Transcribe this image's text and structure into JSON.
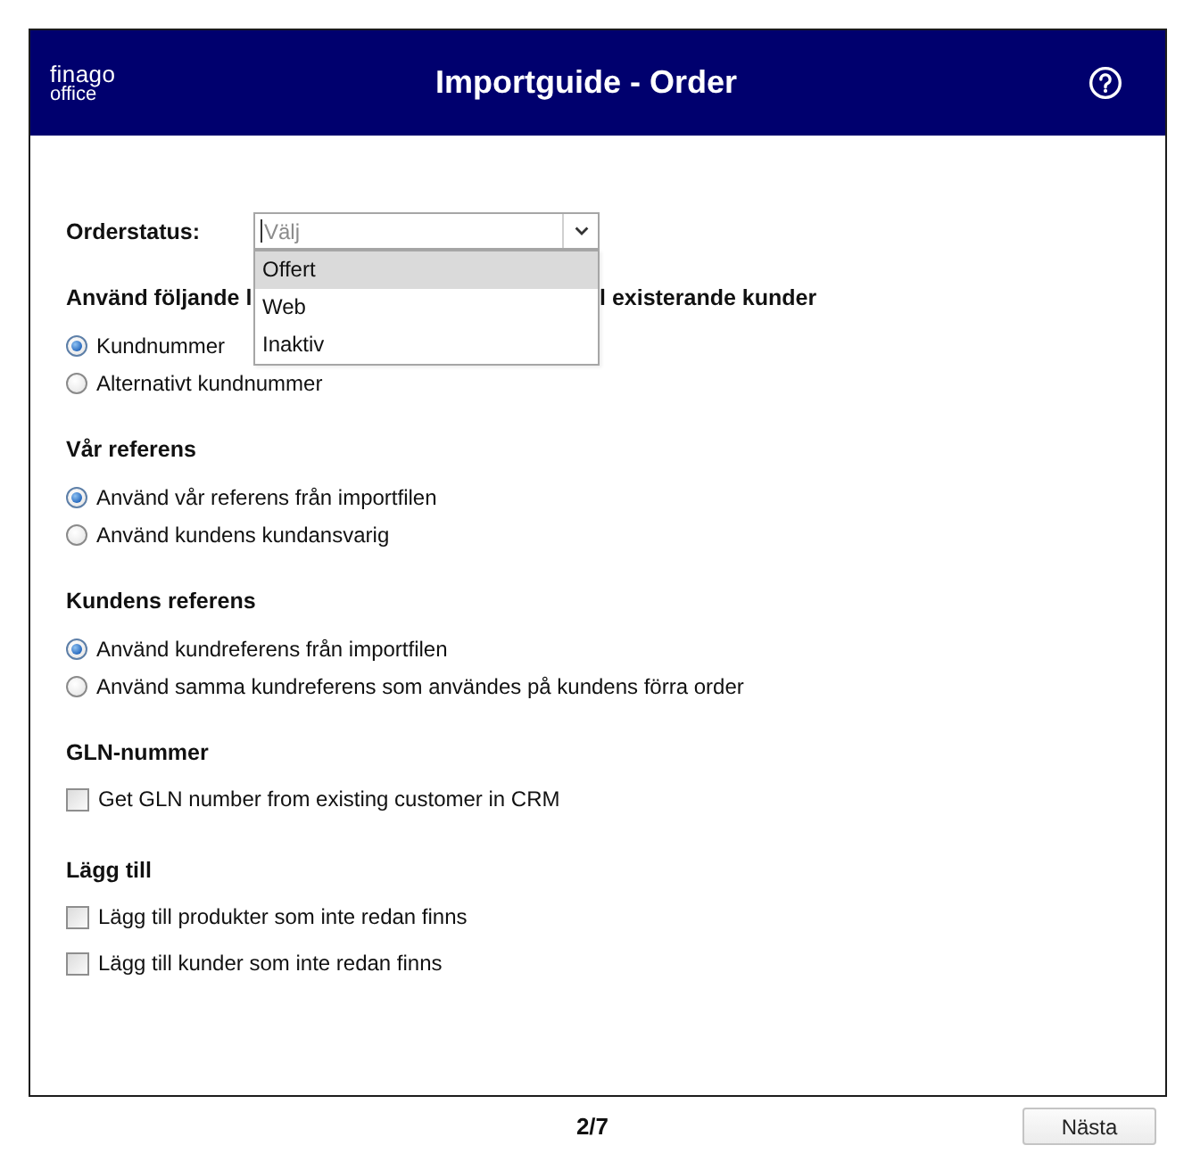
{
  "window": {
    "logo": {
      "line_1": "finago",
      "line_2": "office"
    },
    "title": "Importguide - Order"
  },
  "orderstatus": {
    "label": "Orderstatus:",
    "placeholder": "Välj",
    "focused": true,
    "expanded": true,
    "options": [
      {
        "label": "Offert",
        "selected": true
      },
      {
        "label": "Web",
        "selected": false
      },
      {
        "label": "Inaktiv",
        "selected": false
      }
    ]
  },
  "sections": [
    {
      "heading": "Använd följande l",
      "heading_continued": "l existerande kunder",
      "kind": "radio",
      "options": [
        {
          "label": "Kundnummer",
          "selected": true
        },
        {
          "label": "Alternativt kundnummer",
          "selected": false
        }
      ]
    },
    {
      "heading": "Vår referens",
      "kind": "radio",
      "options": [
        {
          "label": "Använd vår referens från importfilen",
          "selected": true
        },
        {
          "label": "Använd kundens kundansvarig",
          "selected": false
        }
      ]
    },
    {
      "heading": "Kundens referens",
      "kind": "radio",
      "options": [
        {
          "label": "Använd kundreferens från importfilen",
          "selected": true
        },
        {
          "label": "Använd samma kundreferens som användes på kundens förra order",
          "selected": false
        }
      ]
    },
    {
      "heading": "GLN-nummer",
      "kind": "checkbox",
      "options": [
        {
          "label": "Get GLN number from existing customer in CRM",
          "checked": false
        }
      ]
    },
    {
      "heading": "Lägg till",
      "kind": "checkbox",
      "options": [
        {
          "label": "Lägg till produkter som inte redan finns",
          "checked": false
        },
        {
          "label": "Lägg till kunder som inte redan finns",
          "checked": false
        }
      ]
    }
  ],
  "footer": {
    "page": "2/7",
    "next_button": "Nästa"
  }
}
